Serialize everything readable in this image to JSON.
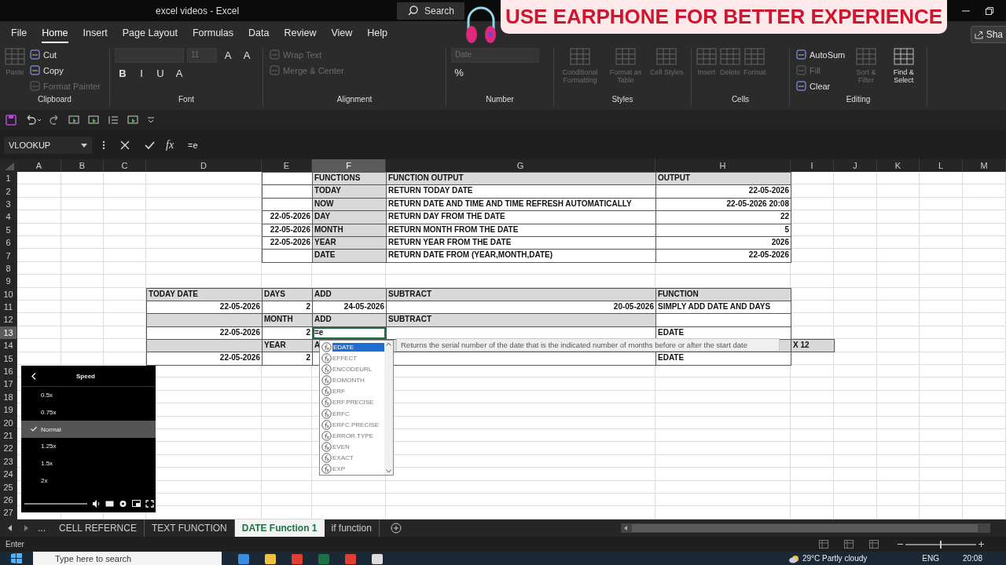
{
  "window": {
    "title": "excel videos  -  Excel",
    "search": "Search"
  },
  "banner": {
    "text": "USE EARPHONE FOR BETTER EXPERIENCE"
  },
  "menu_tabs": [
    {
      "label": "File",
      "selected": false
    },
    {
      "label": "Home",
      "selected": true
    },
    {
      "label": "Insert",
      "selected": false
    },
    {
      "label": "Page Layout",
      "selected": false
    },
    {
      "label": "Formulas",
      "selected": false
    },
    {
      "label": "Data",
      "selected": false
    },
    {
      "label": "Review",
      "selected": false
    },
    {
      "label": "View",
      "selected": false
    },
    {
      "label": "Help",
      "selected": false
    }
  ],
  "share_button": "Sha",
  "ribbon": {
    "groups": [
      {
        "label": "Clipboard",
        "items": [
          {
            "kind": "large",
            "label": "Paste",
            "disabled": true
          },
          {
            "kind": "small",
            "label": "Cut",
            "disabled": false
          },
          {
            "kind": "small",
            "label": "Copy",
            "disabled": false
          },
          {
            "kind": "small",
            "label": "Format Painter",
            "disabled": true
          }
        ]
      },
      {
        "label": "Font",
        "items": [
          {
            "kind": "field",
            "disabled": true
          },
          {
            "kind": "field",
            "value": "11",
            "disabled": true
          },
          {
            "kind": "glyph",
            "label": "A",
            "disabled": false
          },
          {
            "kind": "glyph",
            "label": "A",
            "disabled": false
          },
          {
            "kind": "glyph",
            "label": "B",
            "disabled": false
          },
          {
            "kind": "glyph",
            "label": "I",
            "disabled": false
          },
          {
            "kind": "glyph",
            "label": "U",
            "disabled": false
          },
          {
            "kind": "glyph",
            "label": "A",
            "disabled": false
          }
        ]
      },
      {
        "label": "Alignment",
        "items": [
          {
            "kind": "small",
            "label": "Wrap Text",
            "disabled": true
          },
          {
            "kind": "small",
            "label": "Merge & Center",
            "disabled": true
          }
        ]
      },
      {
        "label": "Number",
        "items": [
          {
            "kind": "field",
            "value": "Date",
            "disabled": true
          },
          {
            "kind": "glyph",
            "label": "%",
            "disabled": false
          }
        ]
      },
      {
        "label": "Styles",
        "items": [
          {
            "kind": "large",
            "label": "Conditional Formatting",
            "disabled": true
          },
          {
            "kind": "large",
            "label": "Format as Table",
            "disabled": true
          },
          {
            "kind": "large",
            "label": "Cell Styles",
            "disabled": true
          }
        ]
      },
      {
        "label": "Cells",
        "items": [
          {
            "kind": "large",
            "label": "Insert",
            "disabled": true
          },
          {
            "kind": "large",
            "label": "Delete",
            "disabled": true
          },
          {
            "kind": "large",
            "label": "Format",
            "disabled": true
          }
        ]
      },
      {
        "label": "Editing",
        "items": [
          {
            "kind": "small",
            "label": "AutoSum",
            "disabled": false
          },
          {
            "kind": "small",
            "label": "Fill",
            "disabled": true
          },
          {
            "kind": "small",
            "label": "Clear",
            "disabled": false
          },
          {
            "kind": "large",
            "label": "Sort & Filter",
            "disabled": true
          },
          {
            "kind": "large",
            "label": "Find & Select",
            "disabled": false
          }
        ]
      }
    ]
  },
  "formula_bar": {
    "name_box": "VLOOKUP",
    "function_button": "fx",
    "formula": "=e"
  },
  "columns": [
    "A",
    "B",
    "C",
    "D",
    "E",
    "F",
    "G",
    "H",
    "I",
    "J",
    "K",
    "L",
    "M"
  ],
  "rows": [
    {
      "number": "1",
      "cells": [
        null,
        null,
        null,
        null,
        {
          "kind": "blank",
          "selected": false
        },
        {
          "kind": "head",
          "text": "FUNCTIONS",
          "selected": false
        },
        {
          "kind": "head",
          "text": "FUNCTION OUTPUT",
          "selected": false
        },
        {
          "kind": "head",
          "text": "OUTPUT",
          "selected": false
        }
      ]
    },
    {
      "number": "2",
      "cells": [
        null,
        null,
        null,
        null,
        {
          "kind": "blank",
          "selected": false
        },
        {
          "kind": "head",
          "text": "TODAY",
          "selected": false
        },
        {
          "kind": "label",
          "text": "RETURN TODAY DATE",
          "selected": false
        },
        {
          "kind": "number",
          "text": "22-05-2026",
          "selected": false
        }
      ]
    },
    {
      "number": "3",
      "cells": [
        null,
        null,
        null,
        null,
        {
          "kind": "blank",
          "selected": false
        },
        {
          "kind": "head",
          "text": "NOW",
          "selected": false
        },
        {
          "kind": "label",
          "text": "RETURN DATE AND TIME AND TIME REFRESH AUTOMATICALLY",
          "selected": false
        },
        {
          "kind": "number",
          "text": "22-05-2026 20:08",
          "selected": false
        }
      ]
    },
    {
      "number": "4",
      "cells": [
        null,
        null,
        null,
        null,
        {
          "kind": "number",
          "text": "22-05-2026",
          "selected": false
        },
        {
          "kind": "head",
          "text": "DAY",
          "selected": false
        },
        {
          "kind": "label",
          "text": "RETURN DAY FROM THE  DATE",
          "selected": false
        },
        {
          "kind": "number",
          "text": "22",
          "selected": false
        }
      ]
    },
    {
      "number": "5",
      "cells": [
        null,
        null,
        null,
        null,
        {
          "kind": "number",
          "text": "22-05-2026",
          "selected": false
        },
        {
          "kind": "head",
          "text": "MONTH",
          "selected": false
        },
        {
          "kind": "label",
          "text": "RETURN MONTH FROM THE DATE",
          "selected": false
        },
        {
          "kind": "number",
          "text": "5",
          "selected": false
        }
      ]
    },
    {
      "number": "6",
      "cells": [
        null,
        null,
        null,
        null,
        {
          "kind": "number",
          "text": "22-05-2026",
          "selected": false
        },
        {
          "kind": "head",
          "text": "YEAR",
          "selected": false
        },
        {
          "kind": "label",
          "text": "RETURN YEAR  FROM THE DATE",
          "selected": false
        },
        {
          "kind": "number",
          "text": "2026",
          "selected": false
        }
      ]
    },
    {
      "number": "7",
      "cells": [
        null,
        null,
        null,
        null,
        {
          "kind": "blank",
          "selected": false
        },
        {
          "kind": "head",
          "text": "DATE",
          "selected": false
        },
        {
          "kind": "label",
          "text": "RETURN DATE FROM (YEAR,MONTH,DATE)",
          "selected": false
        },
        {
          "kind": "number",
          "text": "22-05-2026",
          "selected": false
        }
      ]
    },
    {
      "number": "8"
    },
    {
      "number": "9"
    },
    {
      "number": "10",
      "cells": [
        null,
        null,
        null,
        {
          "kind": "head",
          "text": "TODAY DATE",
          "selected": false
        },
        {
          "kind": "head",
          "text": "DAYS",
          "selected": false
        },
        {
          "kind": "head",
          "text": "ADD",
          "selected": false
        },
        {
          "kind": "head",
          "text": "SUBTRACT",
          "selected": false
        },
        {
          "kind": "head",
          "text": "FUNCTION",
          "selected": false
        }
      ]
    },
    {
      "number": "11",
      "cells": [
        null,
        null,
        null,
        {
          "kind": "number",
          "text": "22-05-2026",
          "selected": false
        },
        {
          "kind": "number",
          "text": "2",
          "selected": false
        },
        {
          "kind": "number",
          "text": "24-05-2026",
          "selected": false
        },
        {
          "kind": "number",
          "text": "20-05-2026",
          "selected": false
        },
        {
          "kind": "label",
          "text": "SIMPLY ADD DATE AND DAYS",
          "selected": false
        }
      ]
    },
    {
      "number": "12",
      "cells": [
        null,
        null,
        null,
        {
          "kind": "head",
          "selected": false
        },
        {
          "kind": "head",
          "text": "MONTH",
          "selected": false
        },
        {
          "kind": "head",
          "text": "ADD",
          "selected": false
        },
        {
          "kind": "head",
          "text": "SUBTRACT",
          "selected": false
        },
        {
          "kind": "blank",
          "selected": false
        }
      ]
    },
    {
      "number": "13",
      "cells": [
        null,
        null,
        null,
        {
          "kind": "number",
          "text": "22-05-2026",
          "selected": false
        },
        {
          "kind": "number",
          "text": "2",
          "selected": false
        },
        {
          "kind": "label",
          "text": "=e",
          "selected": true
        },
        {
          "kind": "blank",
          "selected": false
        },
        {
          "kind": "label",
          "text": "EDATE",
          "selected": false
        }
      ]
    },
    {
      "number": "14",
      "cells": [
        null,
        null,
        null,
        {
          "kind": "head",
          "selected": false
        },
        {
          "kind": "head",
          "text": "YEAR",
          "selected": false
        },
        {
          "kind": "head",
          "text": "A",
          "selected": false
        },
        {
          "kind": "head",
          "selected": false
        },
        {
          "kind": "head",
          "selected": false
        },
        {
          "kind": "head",
          "text": "X 12",
          "selected": false
        }
      ]
    },
    {
      "number": "15",
      "cells": [
        null,
        null,
        null,
        {
          "kind": "number",
          "text": "22-05-2026",
          "selected": false
        },
        {
          "kind": "number",
          "text": "2",
          "selected": false
        },
        {
          "kind": "blank",
          "selected": false
        },
        {
          "kind": "blank",
          "selected": false
        },
        {
          "kind": "label",
          "text": "EDATE",
          "selected": false
        }
      ]
    },
    {
      "number": "16"
    },
    {
      "number": "17"
    },
    {
      "number": "18"
    },
    {
      "number": "19"
    },
    {
      "number": "20"
    },
    {
      "number": "21"
    },
    {
      "number": "22"
    },
    {
      "number": "23"
    },
    {
      "number": "24"
    },
    {
      "number": "25"
    },
    {
      "number": "26"
    },
    {
      "number": "27"
    }
  ],
  "autocomplete": {
    "items": [
      {
        "label": "EDATE",
        "selected": true
      },
      {
        "label": "EFFECT",
        "selected": false
      },
      {
        "label": "ENCODEURL",
        "selected": false
      },
      {
        "label": "EOMONTH",
        "selected": false
      },
      {
        "label": "ERF",
        "selected": false
      },
      {
        "label": "ERF.PRECISE",
        "selected": false
      },
      {
        "label": "ERFC",
        "selected": false
      },
      {
        "label": "ERFC.PRECISE",
        "selected": false
      },
      {
        "label": "ERROR.TYPE",
        "selected": false
      },
      {
        "label": "EVEN",
        "selected": false
      },
      {
        "label": "EXACT",
        "selected": false
      },
      {
        "label": "EXP",
        "selected": false
      }
    ],
    "tooltip": "Returns the serial number of the date that is the indicated number of months before or after the start date"
  },
  "speed_menu": {
    "title": "Speed",
    "options": [
      {
        "label": "0.5x",
        "selected": false
      },
      {
        "label": "0.75x",
        "selected": false
      },
      {
        "label": "Normal",
        "selected": true
      },
      {
        "label": "1.25x",
        "selected": false
      },
      {
        "label": "1.5x",
        "selected": false
      },
      {
        "label": "2x",
        "selected": false
      }
    ]
  },
  "sheet_tabs": {
    "more": "...",
    "tabs": [
      {
        "label": "CELL REFERNCE",
        "selected": false
      },
      {
        "label": "TEXT FUNCTION",
        "selected": false
      },
      {
        "label": "DATE Function 1",
        "selected": true
      },
      {
        "label": "if function",
        "selected": false
      }
    ]
  },
  "status_bar": {
    "mode": "Enter",
    "zoom": {
      "level": 0.5
    }
  },
  "taskbar": {
    "search_placeholder": "Type here to search",
    "weather": "29°C  Partly cloudy",
    "language": "ENG",
    "time": "20:08"
  }
}
